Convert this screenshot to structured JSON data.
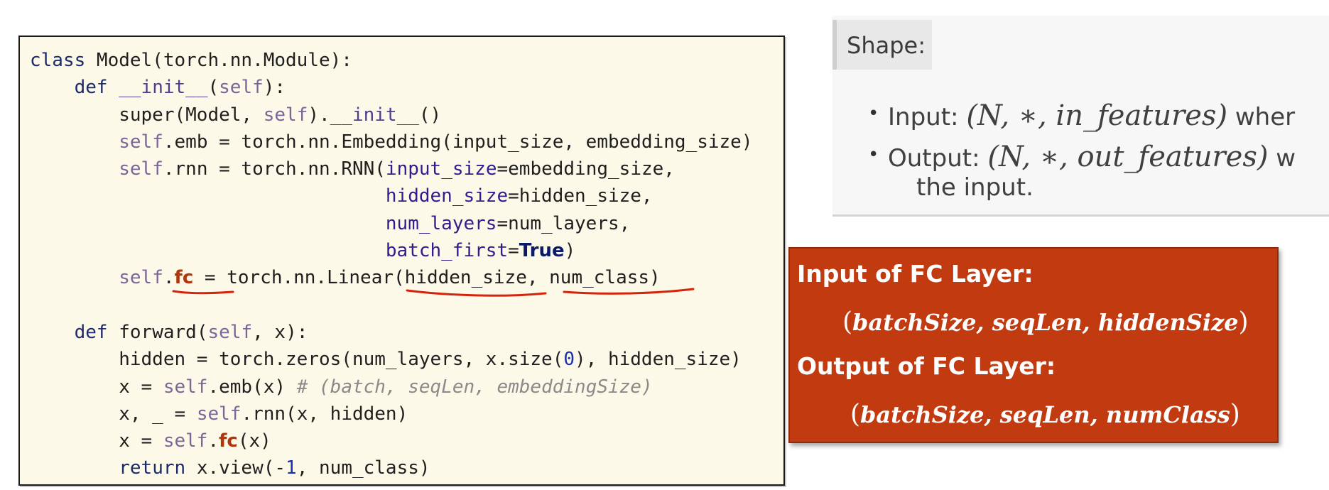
{
  "code_panel": {
    "lines": [
      [
        {
          "t": "class ",
          "c": "tk-kw"
        },
        {
          "t": "Model(torch.nn.Module):"
        }
      ],
      [
        {
          "t": "    "
        },
        {
          "t": "def ",
          "c": "tk-kw"
        },
        {
          "t": "__init__",
          "c": "tk-dunder"
        },
        {
          "t": "("
        },
        {
          "t": "self",
          "c": "tk-self"
        },
        {
          "t": "):"
        }
      ],
      [
        {
          "t": "        super(Model, "
        },
        {
          "t": "self",
          "c": "tk-self"
        },
        {
          "t": ")."
        },
        {
          "t": "__init__",
          "c": "tk-dunder"
        },
        {
          "t": "()"
        }
      ],
      [
        {
          "t": "        "
        },
        {
          "t": "self",
          "c": "tk-self"
        },
        {
          "t": ".emb = torch.nn.Embedding(input_size, embedding_size)"
        }
      ],
      [
        {
          "t": "        "
        },
        {
          "t": "self",
          "c": "tk-self"
        },
        {
          "t": ".rnn = torch.nn.RNN("
        },
        {
          "t": "input_size",
          "c": "tk-kwarg"
        },
        {
          "t": "=embedding_size,"
        }
      ],
      [
        {
          "t": "                                "
        },
        {
          "t": "hidden_size",
          "c": "tk-kwarg"
        },
        {
          "t": "=hidden_size,"
        }
      ],
      [
        {
          "t": "                                "
        },
        {
          "t": "num_layers",
          "c": "tk-kwarg"
        },
        {
          "t": "=num_layers,"
        }
      ],
      [
        {
          "t": "                                "
        },
        {
          "t": "batch_first",
          "c": "tk-kwarg"
        },
        {
          "t": "="
        },
        {
          "t": "True",
          "c": "tk-true"
        },
        {
          "t": ")"
        }
      ],
      [
        {
          "t": "        "
        },
        {
          "t": "self",
          "c": "tk-self"
        },
        {
          "t": "."
        },
        {
          "t": "fc",
          "c": "tk-fc"
        },
        {
          "t": " = torch.nn.Linear(hidden_size, num_class)"
        }
      ],
      [
        {
          "t": ""
        }
      ],
      [
        {
          "t": "    "
        },
        {
          "t": "def ",
          "c": "tk-kw"
        },
        {
          "t": "forward("
        },
        {
          "t": "self",
          "c": "tk-self"
        },
        {
          "t": ", x):"
        }
      ],
      [
        {
          "t": "        hidden = torch.zeros(num_layers, x.size("
        },
        {
          "t": "0",
          "c": "tk-num"
        },
        {
          "t": "), hidden_size)"
        }
      ],
      [
        {
          "t": "        x = "
        },
        {
          "t": "self",
          "c": "tk-self"
        },
        {
          "t": ".emb(x) "
        },
        {
          "t": "# (batch, seqLen, embeddingSize)",
          "c": "tk-cmt"
        }
      ],
      [
        {
          "t": "        x, _ = "
        },
        {
          "t": "self",
          "c": "tk-self"
        },
        {
          "t": ".rnn(x, hidden)"
        }
      ],
      [
        {
          "t": "        x = "
        },
        {
          "t": "self",
          "c": "tk-self"
        },
        {
          "t": "."
        },
        {
          "t": "fc",
          "c": "tk-fc"
        },
        {
          "t": "(x)"
        }
      ],
      [
        {
          "t": "        "
        },
        {
          "t": "return ",
          "c": "tk-kw"
        },
        {
          "t": "x.view(-"
        },
        {
          "t": "1",
          "c": "tk-num"
        },
        {
          "t": ", num_class)"
        }
      ]
    ]
  },
  "doc_card": {
    "heading": "Shape:",
    "input_label": "Input: ",
    "input_math": "(N, ∗, in_features)",
    "input_tail": " wher",
    "output_label": "Output: ",
    "output_math": "(N, ∗, out_features)",
    "output_tail": " w",
    "continuation": "the input."
  },
  "fc_callout": {
    "input_title": "Input of FC Layer:",
    "input_shape": "batchSize, seqLen, hiddenSize",
    "output_title": "Output of FC Layer:",
    "output_shape": "batchSize, seqLen, numClass",
    "open_paren": "(",
    "close_paren": ")"
  },
  "colors": {
    "code_bg": "#fdf9e8",
    "callout_bg": "#c23a10",
    "annotation_red": "#d4250c"
  }
}
